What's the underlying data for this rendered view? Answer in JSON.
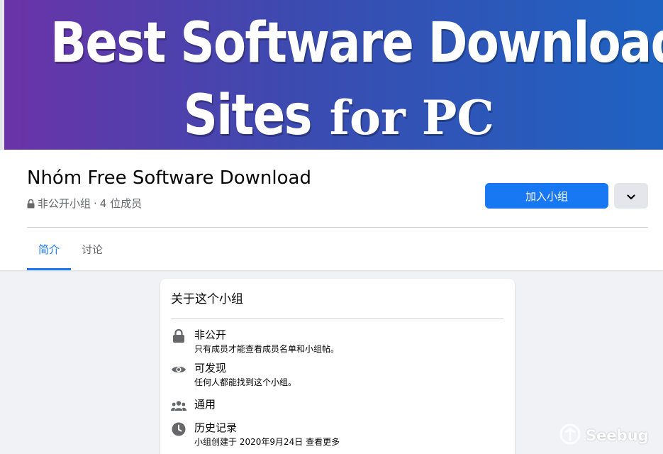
{
  "cover": {
    "line1": "Best Software Download",
    "line2_word1": "Sites",
    "line2_word2": "for PC",
    "colors": {
      "gradient_start": "#6a33a8",
      "gradient_end": "#1e63c2"
    }
  },
  "group": {
    "title": "Nhóm Free Software Download",
    "privacy": "非公开小组",
    "separator": " · ",
    "members": "4 位成员",
    "lock_icon": "lock-icon"
  },
  "actions": {
    "join_label": "加入小组",
    "more_icon": "chevron-down-icon",
    "accent_color": "#1877f2"
  },
  "tabs": [
    {
      "label": "简介",
      "active": true
    },
    {
      "label": "讨论",
      "active": false
    }
  ],
  "about": {
    "title": "关于这个小组",
    "items": [
      {
        "icon": "lock-icon",
        "title": "非公开",
        "desc": "只有成员才能查看成员名单和小组帖。"
      },
      {
        "icon": "eye-icon",
        "title": "可发现",
        "desc": "任何人都能找到这个小组。"
      },
      {
        "icon": "people-icon",
        "title": "通用",
        "desc": ""
      },
      {
        "icon": "clock-icon",
        "title": "历史记录",
        "desc": "小组创建于 2020年9月24日 查看更多"
      }
    ]
  },
  "watermark": {
    "text": "Seebug",
    "icon": "seebug-logo-icon"
  }
}
